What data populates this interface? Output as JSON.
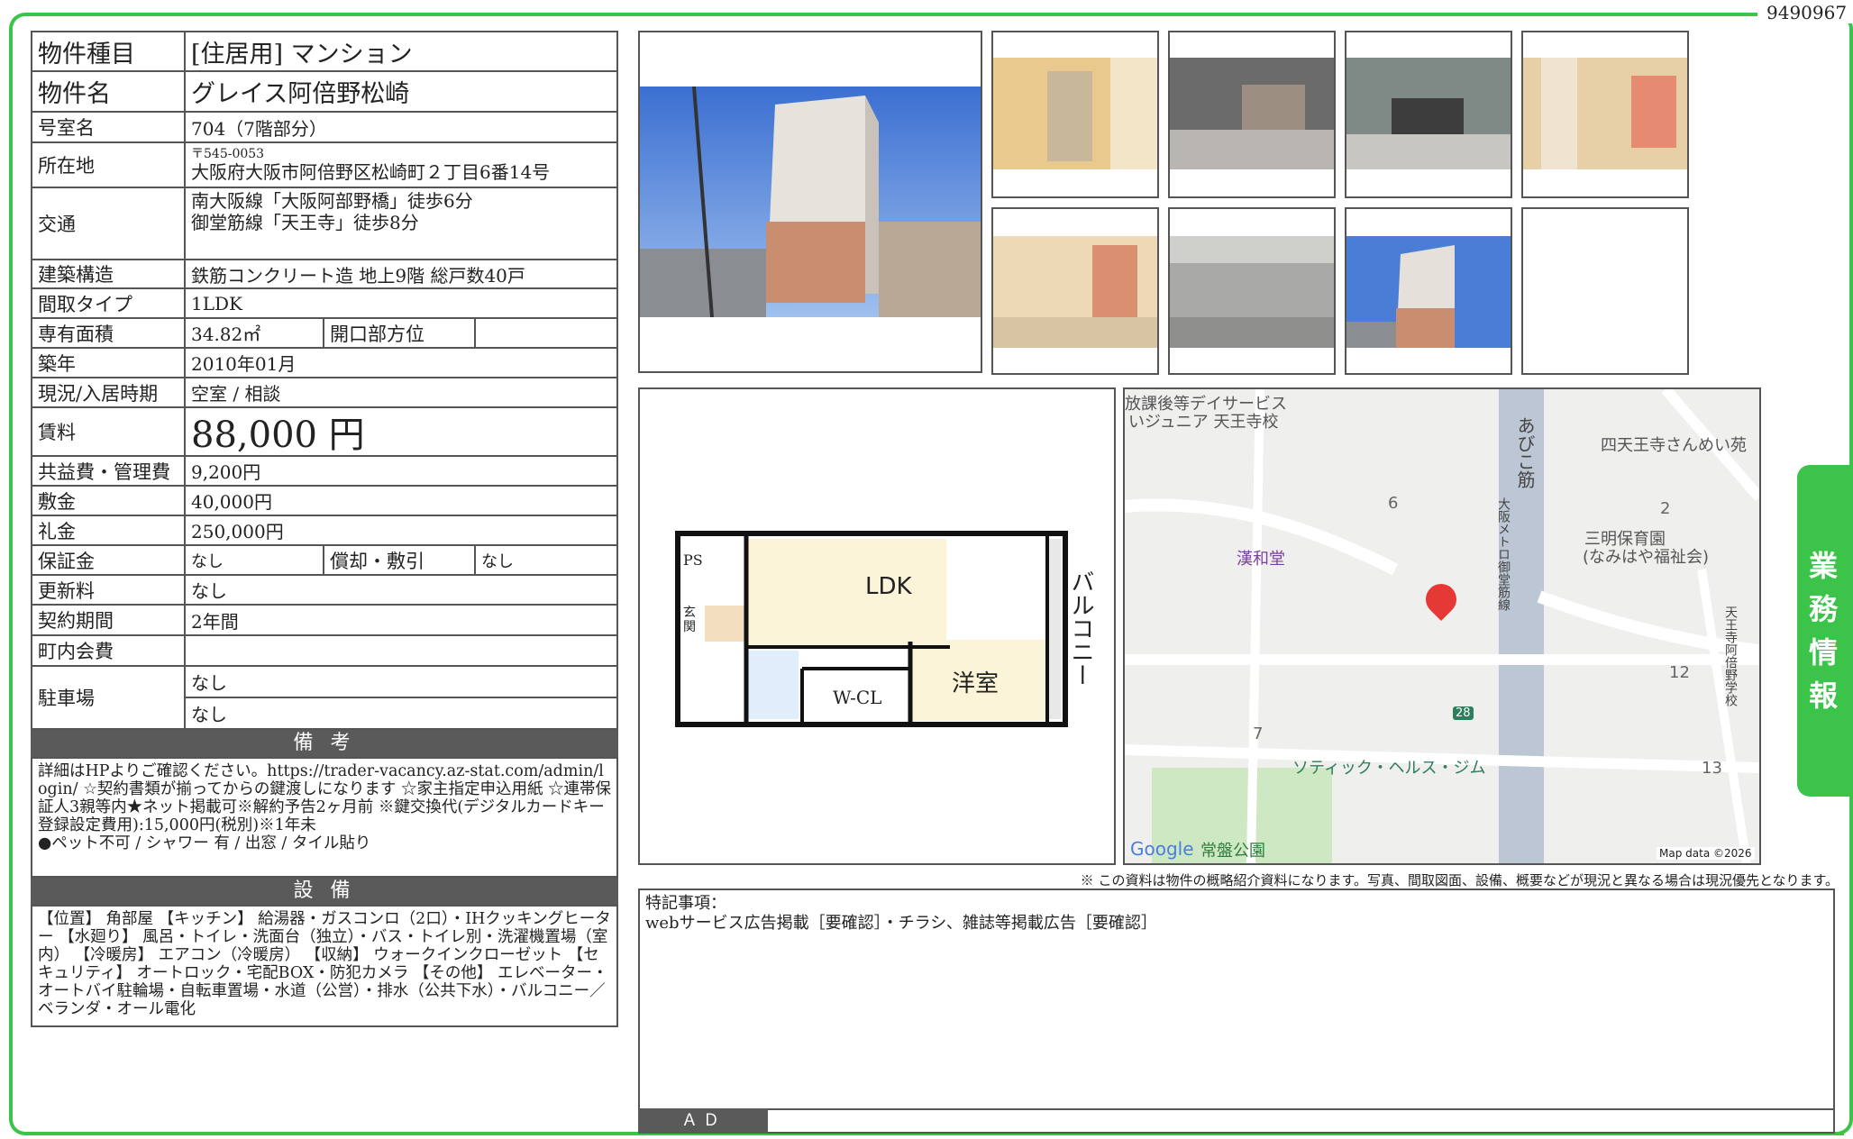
{
  "doc_id": "9490967",
  "side_tab": [
    "業",
    "務",
    "情",
    "報"
  ],
  "property": {
    "type_label": "物件種目",
    "type_value": "[住居用] マンション",
    "name_label": "物件名",
    "name_value": "グレイス阿倍野松崎",
    "room_label": "号室名",
    "room_value": "704（7階部分）",
    "address_label": "所在地",
    "postal": "〒545-0053",
    "address": "大阪府大阪市阿倍野区松崎町２丁目6番14号",
    "transit_label": "交通",
    "transit_1": "南大阪線「大阪阿部野橋」徒歩6分",
    "transit_2": "御堂筋線「天王寺」徒歩8分",
    "structure_label": "建築構造",
    "structure_value": "鉄筋コンクリート造 地上9階 総戸数40戸",
    "layout_label": "間取タイプ",
    "layout_value": "1LDK",
    "area_label": "専有面積",
    "area_value": "34.82㎡",
    "direction_label": "開口部方位",
    "direction_value": "",
    "built_label": "築年",
    "built_value": "2010年01月",
    "status_label": "現況/入居時期",
    "status_value": "空室 / 相談",
    "rent_label": "賃料",
    "rent_value": "88,000 円",
    "fee_label": "共益費・管理費",
    "fee_value": "9,200円",
    "deposit_label": "敷金",
    "deposit_value": "40,000円",
    "key_money_label": "礼金",
    "key_money_value": "250,000円",
    "guarantee_label": "保証金",
    "guarantee_value": "なし",
    "amort_label": "償却・敷引",
    "amort_value": "なし",
    "renewal_label": "更新料",
    "renewal_value": "なし",
    "contract_label": "契約期間",
    "contract_value": "2年間",
    "community_label": "町内会費",
    "community_value": "",
    "parking_label": "駐車場",
    "parking_1": "なし",
    "parking_2": "なし"
  },
  "remarks": {
    "title": "備 考",
    "text": "詳細はHPよりご確認ください。https://trader-vacancy.az-stat.com/admin/login/ ☆契約書類が揃ってからの鍵渡しになります ☆家主指定申込用紙 ☆連帯保証人3親等内★ネット掲載可※解約予告2ヶ月前 ※鍵交換代(デジタルカードキー登録設定費用):15,000円(税別)※1年未",
    "line2": "●ペット不可 / シャワー 有 / 出窓 / タイル貼り"
  },
  "facilities": {
    "title": "設 備",
    "text": "【位置】 角部屋 【キッチン】 給湯器・ガスコンロ（2口）・IHクッキングヒーター 【水廻り】 風呂・トイレ・洗面台（独立）・バス・トイレ別・洗濯機置場（室内） 【冷暖房】 エアコン（冷暖房） 【収納】 ウォークインクローゼット 【セキュリティ】 オートロック・宅配BOX・防犯カメラ 【その他】 エレベーター・オートバイ駐輪場・自転車置場・水道（公営）・排水（公共下水）・バルコニー／ベランダ・オール電化"
  },
  "floorplan": {
    "ldk": "LDK",
    "western": "洋室",
    "wcl": "W-CL",
    "balcony": "バルコニー",
    "ps": "PS",
    "entrance": "玄関"
  },
  "map": {
    "labels": {
      "top1": "放課後等デイサービス",
      "top2": "いジュニア 天王寺校",
      "park_a": "四天王寺さんめい苑",
      "nursery1": "三明保育園",
      "nursery2": "(なみはや福祉会)",
      "kanwa": "漢和堂",
      "gym": "ソティック・ヘルス・ジム",
      "park": "常盤公園",
      "street1": "あびこ筋",
      "street2": "大阪メトロ御堂筋線",
      "street3": "天王寺阿倍野学校",
      "n6": "6",
      "n2": "2",
      "n12": "12",
      "n7": "7",
      "n13": "13",
      "route": "28",
      "google": "Google",
      "mapdata": "Map data ©2026"
    }
  },
  "disclaimer": "※ この資料は物件の概略紹介資料になります。写真、間取図面、設備、概要などが現況と異なる場合は現況優先となります。",
  "notes": {
    "title": "特記事項：",
    "text": "webサービス広告掲載［要確認］・チラシ、雑誌等掲載広告［要確認］"
  },
  "ad_label": "ＡＤ",
  "colors": {
    "accent": "#3cc44a",
    "band": "#5a5a5a",
    "marker": "#e53935"
  }
}
